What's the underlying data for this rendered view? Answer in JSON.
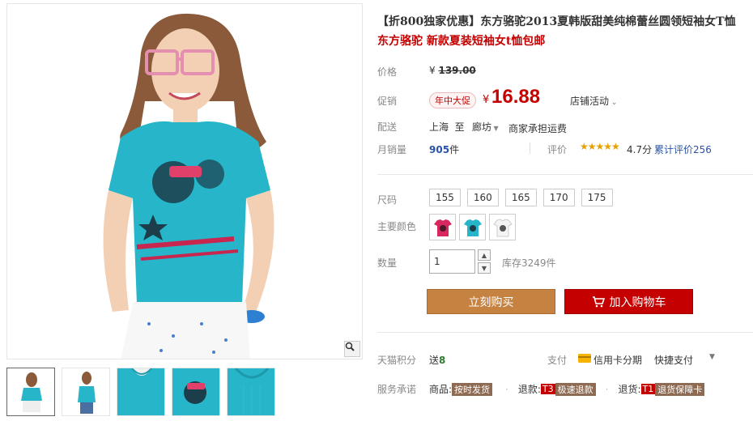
{
  "product": {
    "title": "【折800独家优惠】东方骆驼2013夏韩版甜美纯棉蕾丝圆领短袖女T恤",
    "subtitle": "东方骆驼 新款夏装短袖女t恤包邮"
  },
  "price": {
    "label": "价格",
    "currency": "¥",
    "original": "139.00",
    "promo_label": "促销",
    "promo_badge": "年中大促",
    "current": "16.88",
    "shop_activity": "店铺活动"
  },
  "shipping": {
    "label": "配送",
    "from": "上海",
    "to_word": "至",
    "to_city": "廊坊",
    "note": "商家承担运费"
  },
  "sales": {
    "label": "月销量",
    "count": "905",
    "unit": "件",
    "review_label": "评价",
    "stars": "★★★★★",
    "rating": "4.7分",
    "review_count": "累计评价256"
  },
  "options": {
    "size_label": "尺码",
    "sizes": [
      "155",
      "160",
      "165",
      "170",
      "175"
    ],
    "color_label": "主要颜色",
    "colors": [
      "#d8265f",
      "#27b5c9",
      "#ffffff"
    ]
  },
  "quantity": {
    "label": "数量",
    "value": "1",
    "stock": "库存3249件"
  },
  "actions": {
    "buy_now": "立刻购买",
    "add_cart": "加入购物车"
  },
  "extras": {
    "points_label": "天猫积分",
    "points_prefix": "送",
    "points_value": "8",
    "pay_label": "支付",
    "card_pay": "信用卡分期",
    "quick_pay": "快捷支付",
    "service_label": "服务承诺",
    "goods_label": "商品:",
    "goods_tag": "按时发货",
    "refund_label": "退款:",
    "refund_code": "T3",
    "refund_tag": "极速退款",
    "return_label": "退货:",
    "return_code": "T1",
    "return_tag": "退货保障卡"
  },
  "colors": {
    "accent_red": "#c40000",
    "buy_button": "#c58240",
    "shirt_blue": "#27b5c9"
  }
}
